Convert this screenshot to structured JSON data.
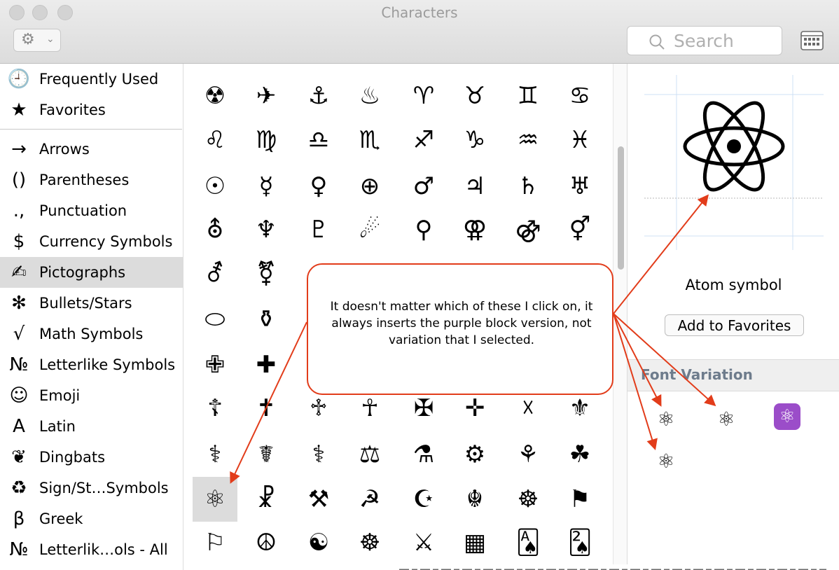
{
  "window": {
    "title": "Characters"
  },
  "toolbar": {
    "search_placeholder": "Search",
    "gear_glyph": "⚙",
    "chevron_glyph": "⌄"
  },
  "sidebar": {
    "items": [
      {
        "icon": "🕘",
        "label": "Frequently Used",
        "name": "clock-icon"
      },
      {
        "icon": "★",
        "label": "Favorites",
        "name": "star-icon"
      },
      {
        "icon": "→",
        "label": "Arrows",
        "name": "arrow-icon"
      },
      {
        "icon": "()",
        "label": "Parentheses",
        "name": "parentheses-icon"
      },
      {
        "icon": ".,",
        "label": "Punctuation",
        "name": "punctuation-icon"
      },
      {
        "icon": "$",
        "label": "Currency Symbols",
        "name": "dollar-icon"
      },
      {
        "icon": "✍",
        "label": "Pictographs",
        "name": "pictograph-icon"
      },
      {
        "icon": "✻",
        "label": "Bullets/Stars",
        "name": "asterisk-icon"
      },
      {
        "icon": "√",
        "label": "Math Symbols",
        "name": "square-root-icon"
      },
      {
        "icon": "№",
        "label": "Letterlike Symbols",
        "name": "numero-icon"
      },
      {
        "icon": "☺",
        "label": "Emoji",
        "name": "smiley-icon"
      },
      {
        "icon": "A",
        "label": "Latin",
        "name": "latin-a-icon"
      },
      {
        "icon": "❦",
        "label": "Dingbats",
        "name": "floral-heart-icon"
      },
      {
        "icon": "♻",
        "label": "Sign/St…Symbols",
        "name": "recycle-icon"
      },
      {
        "icon": "β",
        "label": "Greek",
        "name": "beta-icon"
      },
      {
        "icon": "№",
        "label": "Letterlik…ols - All",
        "name": "numero-icon"
      }
    ],
    "selected": "Pictographs"
  },
  "grid": {
    "rows": [
      [
        "☢",
        "✈",
        "⚓",
        "♨",
        "♈",
        "♉",
        "♊",
        "♋"
      ],
      [
        "♌",
        "♍",
        "♎",
        "♏",
        "♐",
        "♑",
        "♒",
        "♓"
      ],
      [
        "☉",
        "☿",
        "♀",
        "⊕",
        "♂",
        "♃",
        "♄",
        "♅"
      ],
      [
        "⛢",
        "♆",
        "♇",
        "☄",
        "⚲",
        "⚢",
        "⚣",
        "⚥"
      ],
      [
        "⚦",
        "⚧",
        "",
        "",
        "",
        "",
        "",
        ""
      ],
      [
        "⬭",
        "⚱",
        "",
        "",
        "",
        "",
        "",
        ""
      ],
      [
        "✙",
        "✚",
        "",
        "",
        "",
        "",
        "",
        ""
      ],
      [
        "☦",
        "✝",
        "♱",
        "☥",
        "✠",
        "✛",
        "☓",
        "⚜"
      ],
      [
        "⚕",
        "☤",
        "⚕",
        "⚖",
        "⚗",
        "⚙",
        "⚘",
        "☘"
      ],
      [
        "⚛",
        "☧",
        "⚒",
        "☭",
        "☪",
        "☬",
        "☸",
        "⚑"
      ],
      [
        "⚐",
        "☮",
        "☯",
        "☸",
        "⚔",
        "▦",
        "🂡",
        "🂢"
      ]
    ],
    "selected_glyph": "⚛"
  },
  "detail": {
    "character_name": "Atom symbol",
    "add_favorites_label": "Add to Favorites",
    "font_variation_title": "Font Variation",
    "variations": [
      "⚛",
      "⚛",
      "⚛",
      "⚛"
    ]
  },
  "annotation": {
    "text": "It doesn't matter which of these I click on, it always inserts the purple block version, not variation that I selected."
  },
  "colors": {
    "annotation": "#e23c1a",
    "emoji_purple": "#9b4dc9",
    "selected": "#dcdcdc"
  }
}
